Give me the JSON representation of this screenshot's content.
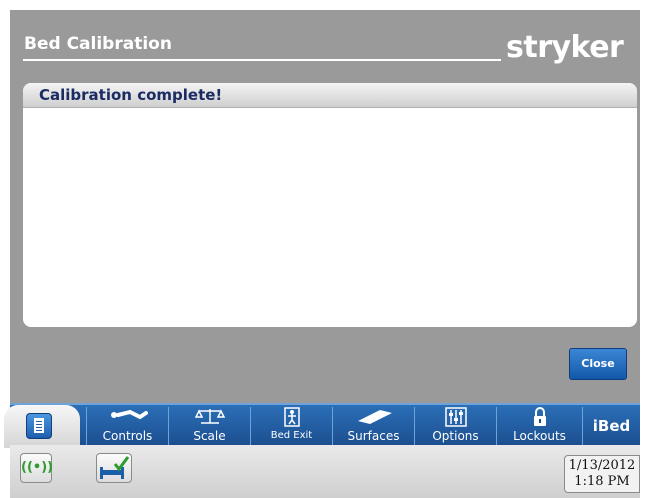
{
  "header": {
    "title": "Bed Calibration",
    "logo": "stryker"
  },
  "panel": {
    "title": "Calibration complete!"
  },
  "actions": {
    "close_label": "Close"
  },
  "nav": {
    "tabs": [
      {
        "label": "Controls",
        "icon": "patient-icon"
      },
      {
        "label": "Scale",
        "icon": "scale-icon"
      },
      {
        "label": "Bed Exit",
        "icon": "bed-exit-icon"
      },
      {
        "label": "Surfaces",
        "icon": "surface-icon"
      },
      {
        "label": "Options",
        "icon": "sliders-icon"
      },
      {
        "label": "Lockouts",
        "icon": "lock-icon"
      }
    ],
    "ibed_label": "iBed"
  },
  "status": {
    "date": "1/13/2012",
    "time": "1:18 PM"
  },
  "colors": {
    "background": "#9a9a9a",
    "nav": "#2b6fb8",
    "accent": "#1b2b63",
    "wifi": "#2e9b2e"
  }
}
